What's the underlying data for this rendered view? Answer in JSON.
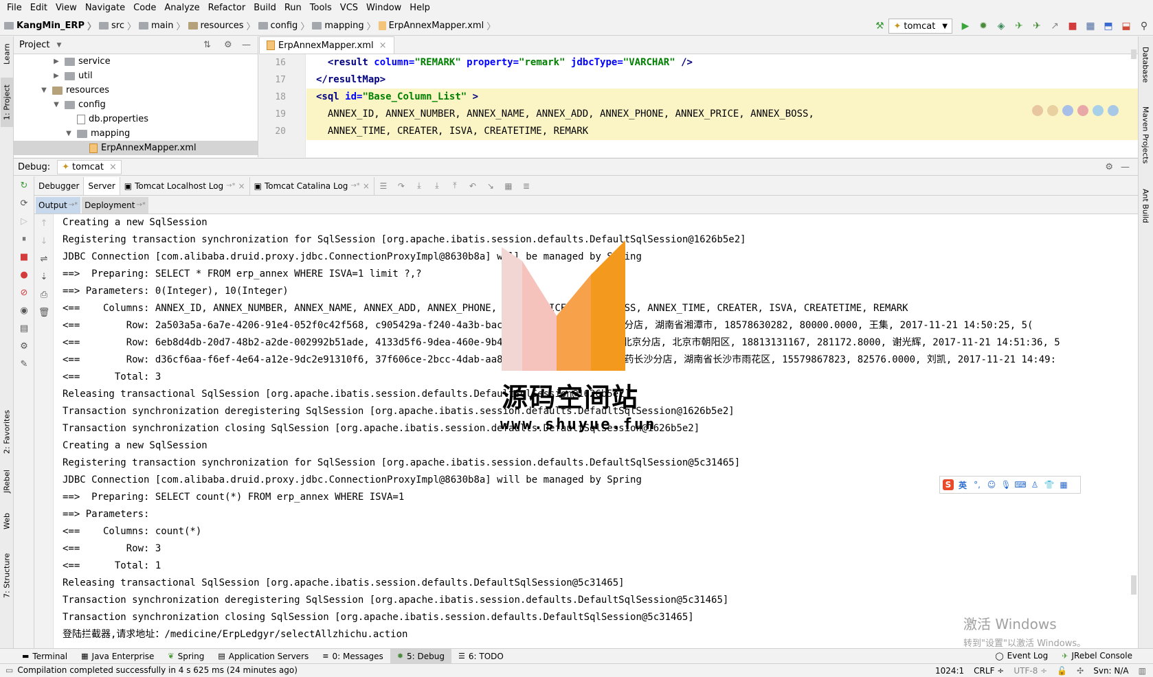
{
  "menu": [
    "File",
    "Edit",
    "View",
    "Navigate",
    "Code",
    "Analyze",
    "Refactor",
    "Build",
    "Run",
    "Tools",
    "VCS",
    "Window",
    "Help"
  ],
  "breadcrumbs": [
    "KangMin_ERP",
    "src",
    "main",
    "resources",
    "config",
    "mapping",
    "ErpAnnexMapper.xml"
  ],
  "run_config": "tomcat",
  "left_strip": [
    "1: Project",
    "Learn",
    "2: Favorites",
    "JRebel",
    "Web",
    "7: Structure"
  ],
  "right_strip": [
    "Database",
    "Maven Projects",
    "Ant Build"
  ],
  "project_panel": {
    "title": "Project",
    "tree": [
      {
        "label": "service",
        "indent": 2,
        "type": "folder",
        "arrow": "▶"
      },
      {
        "label": "util",
        "indent": 2,
        "type": "folder",
        "arrow": "▶"
      },
      {
        "label": "resources",
        "indent": 1,
        "type": "res",
        "arrow": "▼"
      },
      {
        "label": "config",
        "indent": 2,
        "type": "folder",
        "arrow": "▼"
      },
      {
        "label": "db.properties",
        "indent": 3,
        "type": "file",
        "arrow": ""
      },
      {
        "label": "mapping",
        "indent": 3,
        "type": "folder",
        "arrow": "▼"
      },
      {
        "label": "ErpAnnexMapper.xml",
        "indent": 4,
        "type": "xml",
        "arrow": ""
      }
    ]
  },
  "editor": {
    "tab": "ErpAnnexMapper.xml",
    "line_numbers": [
      "16",
      "17",
      "18",
      "19",
      "20"
    ],
    "lines": [
      {
        "html": "  <span class=\"tag\">&lt;result </span><span class=\"attr\">column=</span><span class=\"val\">\"REMARK\"</span><span class=\"attr\"> property=</span><span class=\"val\">\"remark\"</span><span class=\"attr\"> jdbcType=</span><span class=\"val\">\"VARCHAR\"</span><span class=\"tag\"> /&gt;</span>",
        "hl": false
      },
      {
        "html": "<span class=\"tag\">&lt;/resultMap&gt;</span>",
        "hl": false
      },
      {
        "html": "<span class=\"tag\">&lt;sql </span><span class=\"attr\">id=</span><span class=\"val\">\"Base_Column_List\"</span><span class=\"tag\"> &gt;</span>",
        "hl": true
      },
      {
        "html": "  ANNEX_ID, ANNEX_NUMBER, ANNEX_NAME, ANNEX_ADD, ANNEX_PHONE, ANNEX_PRICE, ANNEX_BOSS,",
        "hl": true
      },
      {
        "html": "  ANNEX_TIME, CREATER, ISVA, CREATETIME, REMARK",
        "hl": true
      }
    ]
  },
  "debug": {
    "label": "Debug:",
    "session": "tomcat",
    "tabs": [
      "Debugger",
      "Server",
      "Tomcat Localhost Log",
      "Tomcat Catalina Log"
    ],
    "output_tabs": [
      "Output",
      "Deployment"
    ]
  },
  "console_lines": [
    "Creating a new SqlSession",
    "Registering transaction synchronization for SqlSession [org.apache.ibatis.session.defaults.DefaultSqlSession@1626b5e2]",
    "JDBC Connection [com.alibaba.druid.proxy.jdbc.ConnectionProxyImpl@8630b8a] will be managed by Spring",
    "==>  Preparing: SELECT * FROM erp_annex WHERE ISVA=1 limit ?,?",
    "==> Parameters: 0(Integer), 10(Integer)",
    "<==    Columns: ANNEX_ID, ANNEX_NUMBER, ANNEX_NAME, ANNEX_ADD, ANNEX_PHONE, ANNEX_PRICE, ANNEX_BOSS, ANNEX_TIME, CREATER, ISVA, CREATETIME, REMARK",
    "<==        Row: 2a503a5a-6a7e-4206-91e4-052f0c42f568, c905429a-f240-4a3b-bac-16887ccc, 康源医药湘潭分店, 湖南省湘潭市, 18578630282, 80000.0000, 王集, 2017-11-21 14:50:25, 5(",
    "<==        Row: 6eb8d4db-20d7-48b2-a2de-002992b51ade, 4133d5f6-9dea-460e-9b4-6ecc48cf6f5, 康源医药北京分店, 北京市朝阳区, 18813131167, 281172.8000, 谢光辉, 2017-11-21 14:51:36, 5",
    "<==        Row: d36cf6aa-f6ef-4e64-a12e-9dc2e91310f6, 37f606ce-2bcc-4dab-aa8a-d6f854a0feee, 康源医药长沙分店, 湖南省长沙市雨花区, 15579867823, 82576.0000, 刘凯, 2017-11-21 14:49:",
    "<==      Total: 3",
    "Releasing transactional SqlSession [org.apache.ibatis.session.defaults.DefaultSqlSession@1626b5e2]",
    "Transaction synchronization deregistering SqlSession [org.apache.ibatis.session.defaults.DefaultSqlSession@1626b5e2]",
    "Transaction synchronization closing SqlSession [org.apache.ibatis.session.defaults.DefaultSqlSession@1626b5e2]",
    "Creating a new SqlSession",
    "Registering transaction synchronization for SqlSession [org.apache.ibatis.session.defaults.DefaultSqlSession@5c31465]",
    "JDBC Connection [com.alibaba.druid.proxy.jdbc.ConnectionProxyImpl@8630b8a] will be managed by Spring",
    "==>  Preparing: SELECT count(*) FROM erp_annex WHERE ISVA=1",
    "==> Parameters: ",
    "<==    Columns: count(*)",
    "<==        Row: 3",
    "<==      Total: 1",
    "Releasing transactional SqlSession [org.apache.ibatis.session.defaults.DefaultSqlSession@5c31465]",
    "Transaction synchronization deregistering SqlSession [org.apache.ibatis.session.defaults.DefaultSqlSession@5c31465]",
    "Transaction synchronization closing SqlSession [org.apache.ibatis.session.defaults.DefaultSqlSession@5c31465]",
    "登陆拦截器,请求地址：/medicine/ErpLedgyr/selectAllzhichu.action"
  ],
  "watermark": {
    "title": "源码空间站",
    "url": "www.shuyue.fun"
  },
  "ime": {
    "lang": "英"
  },
  "activate": {
    "line1": "激活 Windows",
    "line2": "转到\"设置\"以激活 Windows。"
  },
  "bottom_tabs": [
    "Terminal",
    "Java Enterprise",
    "Spring",
    "Application Servers",
    "0: Messages",
    "5: Debug",
    "6: TODO"
  ],
  "bottom_right_tabs": [
    "Event Log",
    "JRebel Console"
  ],
  "status": {
    "message": "Compilation completed successfully in 4 s 625 ms (24 minutes ago)",
    "position": "1024:1",
    "line_sep": "CRLF",
    "encoding": "UTF-8",
    "vcs": "Svn: N/A"
  }
}
